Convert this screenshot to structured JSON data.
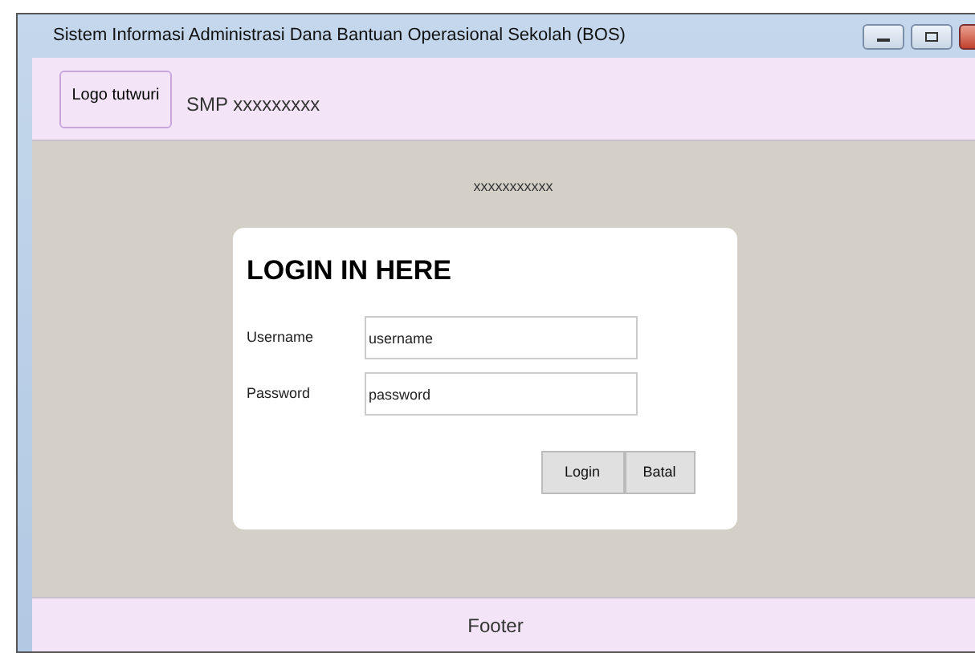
{
  "window": {
    "title": "Sistem Informasi Administrasi Dana Bantuan Operasional Sekolah (BOS)"
  },
  "header": {
    "logo": "Logo tutwuri",
    "school": "SMP xxxxxxxxx"
  },
  "subtitle": "xxxxxxxxxxx",
  "login": {
    "heading": "LOGIN IN HERE",
    "fields": [
      {
        "label": "Username",
        "value": "username"
      },
      {
        "label": "Password",
        "value": "password"
      }
    ],
    "buttons": [
      "Login",
      "Batal"
    ]
  },
  "footer": "Footer"
}
